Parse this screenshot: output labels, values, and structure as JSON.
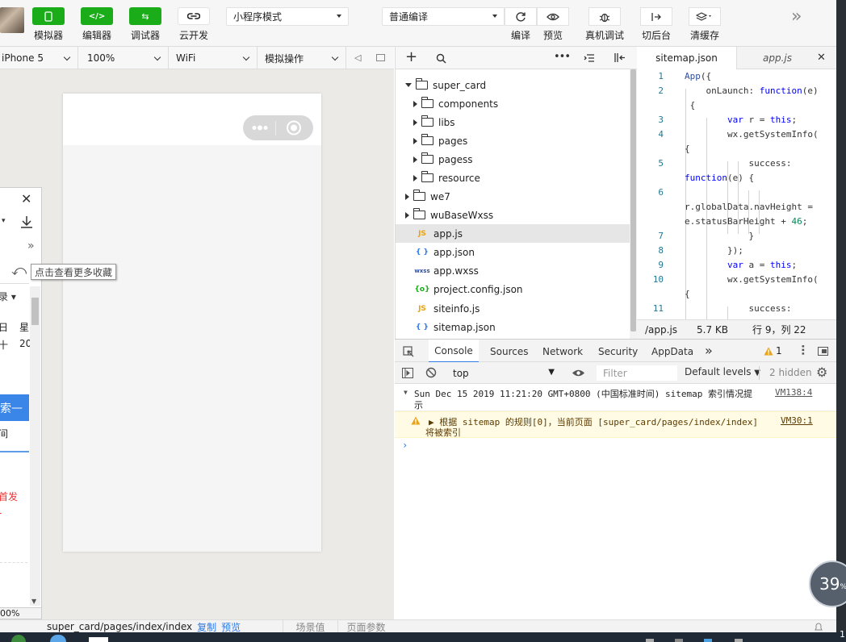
{
  "toolbar": {
    "buttons": [
      {
        "label": "模拟器",
        "icon": "phone-icon"
      },
      {
        "label": "编辑器",
        "icon": "code-icon"
      },
      {
        "label": "调试器",
        "icon": "debug-icon"
      },
      {
        "label": "云开发",
        "icon": "cloud-link-icon"
      }
    ],
    "mode_select": "小程序模式",
    "compile_select": "普通编译",
    "actions": [
      {
        "label": "编译",
        "icon": "refresh-icon"
      },
      {
        "label": "预览",
        "icon": "eye-icon"
      },
      {
        "label": "真机调试",
        "icon": "bug-icon"
      },
      {
        "label": "切后台",
        "icon": "switch-background-icon"
      },
      {
        "label": "清缓存",
        "icon": "layers-icon"
      }
    ],
    "more": "»",
    "accent": "#1aad19"
  },
  "simulator": {
    "device": "iPhone 5",
    "zoom": "100%",
    "network": "WiFi",
    "operation": "模拟操作"
  },
  "side_panel": {
    "tooltip": "点击查看更多收藏",
    "texts": [
      "录",
      "日",
      "星",
      "十",
      "20",
      "搜索",
      "间",
      "首发"
    ],
    "zoom_fragment": "00%"
  },
  "file_tree": {
    "items": [
      {
        "name": "super_card",
        "type": "folder",
        "open": true
      },
      {
        "name": "components",
        "type": "folder"
      },
      {
        "name": "libs",
        "type": "folder"
      },
      {
        "name": "pages",
        "type": "folder"
      },
      {
        "name": "pagess",
        "type": "folder"
      },
      {
        "name": "resource",
        "type": "folder"
      },
      {
        "name": "we7",
        "type": "folder"
      },
      {
        "name": "wuBaseWxss",
        "type": "folder"
      },
      {
        "name": "app.js",
        "type": "js",
        "badge": "JS",
        "selected": true
      },
      {
        "name": "app.json",
        "type": "json",
        "badge": "{ }"
      },
      {
        "name": "app.wxss",
        "type": "wxss",
        "badge": "wxss"
      },
      {
        "name": "project.config.json",
        "type": "config",
        "badge": "{o}"
      },
      {
        "name": "siteinfo.js",
        "type": "js",
        "badge": "JS"
      },
      {
        "name": "sitemap.json",
        "type": "json",
        "badge": "{ }"
      }
    ]
  },
  "editor": {
    "tabs": [
      {
        "label": "sitemap.json",
        "active": true
      },
      {
        "label": "app.js",
        "active": false
      }
    ],
    "lines": [
      {
        "n": "1",
        "text": "App({"
      },
      {
        "n": "2",
        "text": "    onLaunch: function(e)"
      },
      {
        "n": "",
        "text": " {"
      },
      {
        "n": "3",
        "text": "        var r = this;"
      },
      {
        "n": "4",
        "text": "        wx.getSystemInfo("
      },
      {
        "n": "",
        "text": "{"
      },
      {
        "n": "5",
        "text": "            success:"
      },
      {
        "n": "",
        "text": "function(e) {"
      },
      {
        "n": "6",
        "text": ""
      },
      {
        "n": "",
        "text": "r.globalData.navHeight ="
      },
      {
        "n": "",
        "text": "e.statusBarHeight + 46;"
      },
      {
        "n": "7",
        "text": "            }"
      },
      {
        "n": "8",
        "text": "        });"
      },
      {
        "n": "9",
        "text": "        var a = this;"
      },
      {
        "n": "10",
        "text": "        wx.getSystemInfo("
      },
      {
        "n": "",
        "text": "{"
      },
      {
        "n": "11",
        "text": "            success:"
      }
    ],
    "status": {
      "file": "/app.js",
      "size": "5.7 KB",
      "cursor": "行 9，列 22"
    }
  },
  "devtools": {
    "tabs": [
      "Console",
      "Sources",
      "Network",
      "Security",
      "AppData"
    ],
    "active_tab": "Console",
    "warning_count": "1",
    "context": "top",
    "filter_placeholder": "Filter",
    "levels": "Default levels",
    "hidden": "2 hidden",
    "messages": [
      {
        "level": "info",
        "text": "Sun Dec 15 2019 11:21:20 GMT+0800 (中国标准时间) sitemap 索引情况提",
        "text2": "示",
        "source": "VM138:4"
      },
      {
        "level": "warn",
        "text": "▶ 根据 sitemap 的规则[0]，当前页面 [super_card/pages/index/index]",
        "text2": "将被索引",
        "source": "VM30:1"
      }
    ]
  },
  "statusbar": {
    "path": "super_card/pages/index/index",
    "copy": "复制",
    "preview": "预览",
    "scene": "场景值",
    "params": "页面参数"
  },
  "overlay": {
    "percent": "39",
    "unit": "%"
  },
  "taskbar_clock_fragment": "1"
}
